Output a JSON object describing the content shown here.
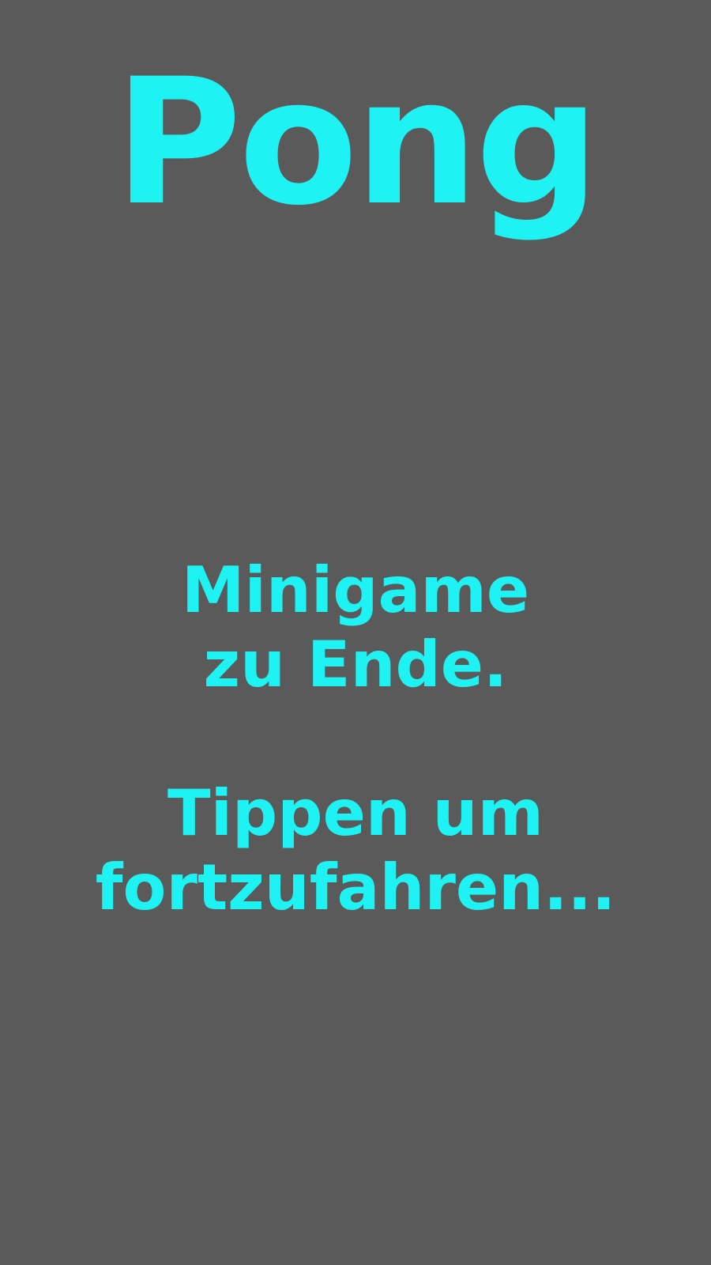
{
  "game": {
    "title": "Pong",
    "end_message": {
      "line1": "Minigame",
      "line2": "zu Ende."
    },
    "prompt": {
      "line1": "Tippen um",
      "line2": "fortzufahren..."
    },
    "colors": {
      "background": "#5a5a5a",
      "text": "#1ff2f2"
    }
  }
}
